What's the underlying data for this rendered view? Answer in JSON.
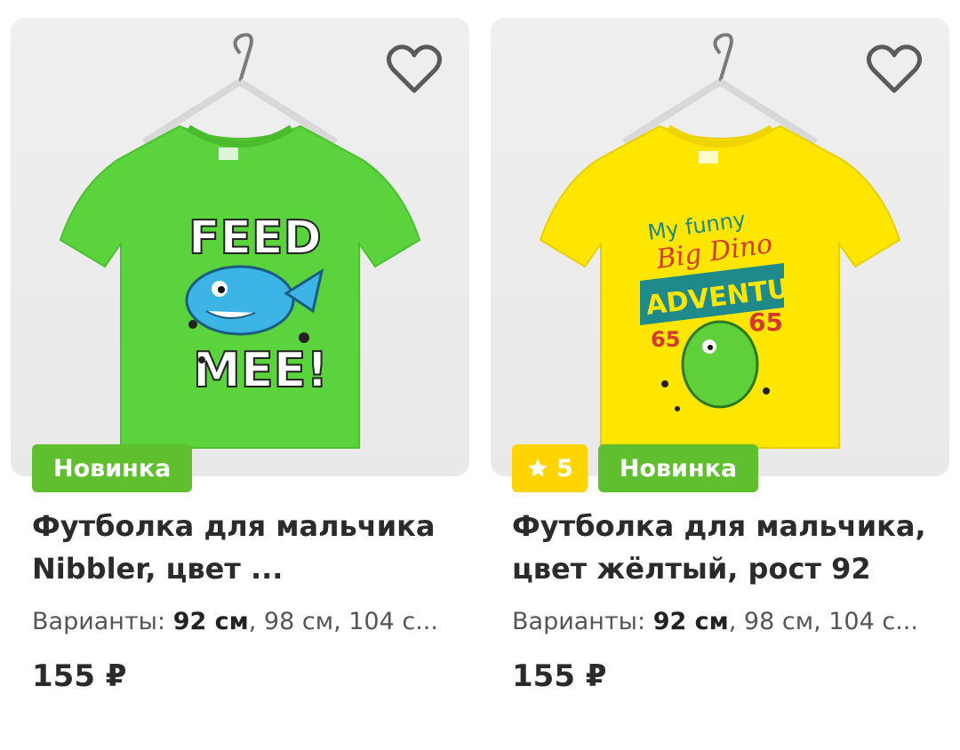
{
  "products": [
    {
      "title": "Футболка для мальчика Nibbler, цвет ...",
      "variants_label": "Варианты:",
      "variant_selected": "92 см",
      "variants_rest": ", 98 см, 104 с...",
      "price": "155 ₽",
      "badge_new": "Новинка",
      "shirt_color": "#5ad33c",
      "print_text_top": "FEED",
      "print_text_bottom": "MEE!",
      "favorite_icon": "heart-outline-icon"
    },
    {
      "title": "Футболка для мальчика, цвет жёлтый, рост 92",
      "variants_label": "Варианты:",
      "variant_selected": "92 см",
      "variants_rest": ", 98 см, 104 с...",
      "price": "155 ₽",
      "badge_rating_value": "5",
      "badge_new": "Новинка",
      "shirt_color": "#ffe600",
      "print_text_top": "My funny",
      "print_text_mid": "Big Dino",
      "print_text_banner": "ADVENTURE",
      "print_number": "65",
      "favorite_icon": "heart-outline-icon",
      "rating_icon": "star-icon"
    }
  ],
  "colors": {
    "badge_new": "#5fbf2f",
    "badge_rating": "#ffd400",
    "text_primary": "#2b2b2b"
  }
}
